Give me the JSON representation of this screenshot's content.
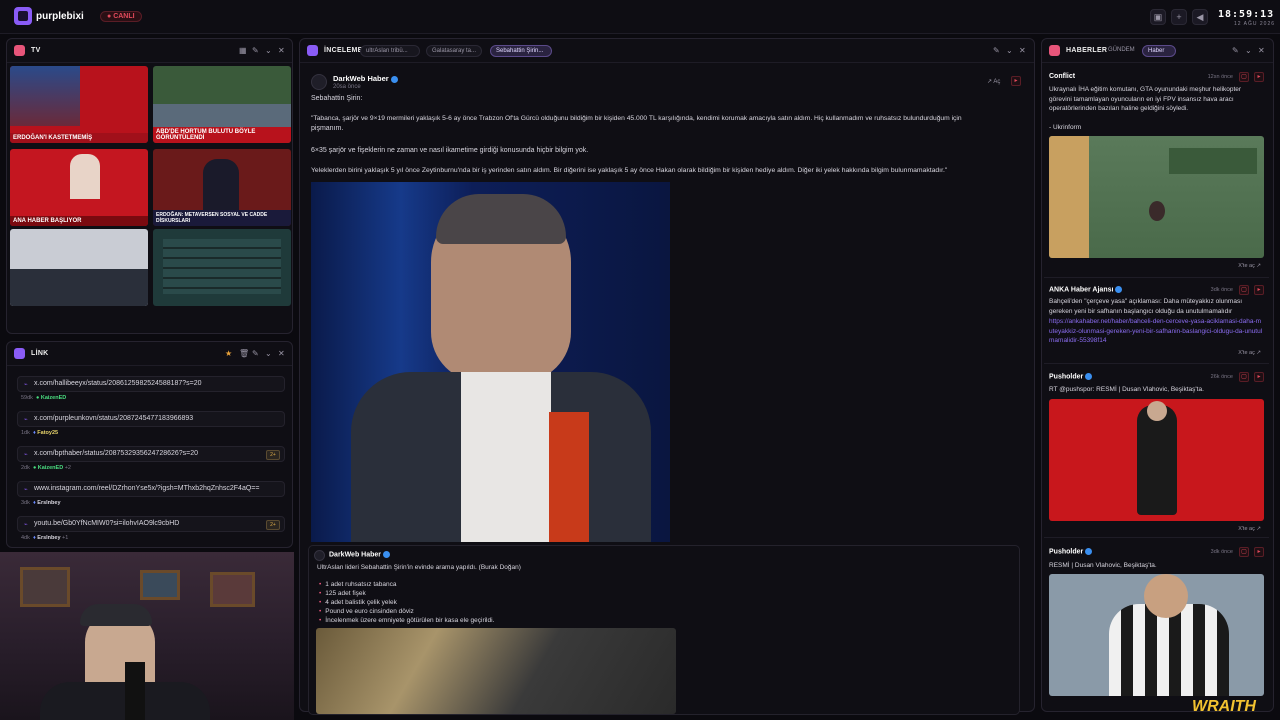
{
  "topbar": {
    "brand": "purplebixi",
    "live": "CANLI",
    "time": "18:59:13",
    "date": "12 AĞU 2026",
    "icons": [
      "image-icon",
      "plus-icon",
      "volume-icon"
    ]
  },
  "tv": {
    "title": "TV",
    "tiles": [
      {
        "caption": "ERDOĞAN'I KASTETMEMİŞ",
        "bg": "#b8121c"
      },
      {
        "caption": "ABD'DE HORTUM BULUTU BÖYLE GÖRÜNTÜLENDİ",
        "bg": "#3a5a3a"
      },
      {
        "caption": "ANA HABER BAŞLIYOR",
        "bg": "#c41620"
      },
      {
        "caption": "ERDOĞAN: METAVERSEN SOSYAL VE CADDE DİSKURSLARI",
        "bg": "#6a1a1a"
      },
      {
        "caption": "",
        "bg": "#c9ccd4"
      },
      {
        "caption": "",
        "bg": "#1f3a3a"
      }
    ]
  },
  "link": {
    "title": "LİNK",
    "items": [
      {
        "url": "x.com/hallibeeyx/status/2086125982524588187?s=20",
        "time": "59dk",
        "user": "KaizenED",
        "user_color": "#4ade80",
        "extra": "",
        "badge": ""
      },
      {
        "url": "x.com/purpleunkovn/status/2087245477183966893",
        "time": "1dk",
        "user": "Fatoy25",
        "user_color": "#e8d46a",
        "extra": "",
        "badge": ""
      },
      {
        "url": "x.com/bpthaber/status/2087532935624728626?s=20",
        "time": "2dk",
        "user": "KaizenED",
        "user_color": "#4ade80",
        "extra": "+2",
        "badge": "2+"
      },
      {
        "url": "www.instagram.com/reel/DZrhonYse5x/?igsh=MThxb2hqZnhsc2F4aQ==",
        "time": "3dk",
        "user": "Erslnbey",
        "user_color": "#d8d6df",
        "extra": "",
        "badge": ""
      },
      {
        "url": "youtu.be/Gb0YfNcMIW0?si=ilohvIAO9lc9cbHD",
        "time": "4dk",
        "user": "Erslnbey",
        "user_color": "#d8d6df",
        "extra": "+1",
        "badge": "2+"
      }
    ]
  },
  "inceleme": {
    "title": "İNCELEME",
    "tabs": [
      "ultrAslan tribü...",
      "Galatasaray ta...",
      "Sebahattin Şirin..."
    ],
    "post": {
      "author": "DarkWeb Haber",
      "time": "20sa önce",
      "open_label": "Aç",
      "lines": [
        "Sebahattin Şirin:",
        "\"Tabanca, şarjör ve 9×19 mermileri yaklaşık 5-6 ay önce Trabzon Of'ta Gürcü olduğunu bildiğim bir kişiden 45.000 TL karşılığında, kendimi korumak amacıyla satın aldım. Hiç kullanmadım ve ruhsatsız bulundurduğum için",
        "pişmanım.",
        "6×35 şarjör ve fişeklerin ne zaman ve nasıl ikametime girdiği konusunda hiçbir bilgim yok.",
        "Yeleklerden birini yaklaşık 5 yıl önce Zeytinburnu'nda bir iş yerinden satın aldım. Bir diğerini ise yaklaşık 5 ay önce Hakan olarak bildiğim bir kişiden hediye aldım. Diğer iki yelek hakkında bilgim bulunmamaktadır.\""
      ]
    },
    "post2": {
      "author": "DarkWeb Haber",
      "text": "UltrAslan lideri Sebahattin Şirin'in evinde arama yapıldı. (Burak Doğan)",
      "bullets": [
        "1 adet ruhsatsız tabanca",
        "125 adet fişek",
        "4 adet balistik çelik yelek",
        "Pound ve euro cinsinden döviz",
        "İncelenmek üzere emniyete götürülen bir kasa ele geçirildi."
      ]
    }
  },
  "haberler": {
    "title": "HABERLER",
    "tabs": [
      "GÜNDEM",
      "Haber"
    ],
    "cards": [
      {
        "source": "Conflict",
        "time": "12sn önce",
        "text": "Ukraynalı İHA eğitim komutanı, GTA oyunundaki meşhur helikopter görevini tamamlayan oyuncuların en iyi FPV insansız hava aracı operatörlerinden bazıları haline geldiğini söyledi.",
        "text2": "- Ukrinform",
        "link": "",
        "open": "X'te aç"
      },
      {
        "source": "ANKA Haber Ajansı",
        "time": "3dk önce",
        "text": "Bahçeli'den \"çerçeve yasa\" açıklaması: Daha müteyakkız olunması gereken yeni bir safhanın başlangıcı olduğu da unutulmamalıdır",
        "text2": "",
        "link": "https://ankahaber.net/haber/bahceli-den-cerceve-yasa-aciklamasi-daha-muteyakkiz-olunmasi-gereken-yeni-bir-safhanin-baslangici-oldugu-da-unutulmamalidir-55398f14",
        "open": "X'te aç"
      },
      {
        "source": "Pusholder",
        "time": "26k önce",
        "text": "RT @pushspor: RESMİ | Dusan Vlahovic, Beşiktaş'ta.",
        "text2": "",
        "link": "",
        "open": "X'te aç"
      },
      {
        "source": "Pusholder",
        "time": "3dk önce",
        "text": "RESMİ | Dusan Vlahovic, Beşiktaş'ta.",
        "text2": "",
        "link": "",
        "open": ""
      }
    ]
  },
  "overlay": {
    "wraith": "WRAITH"
  }
}
